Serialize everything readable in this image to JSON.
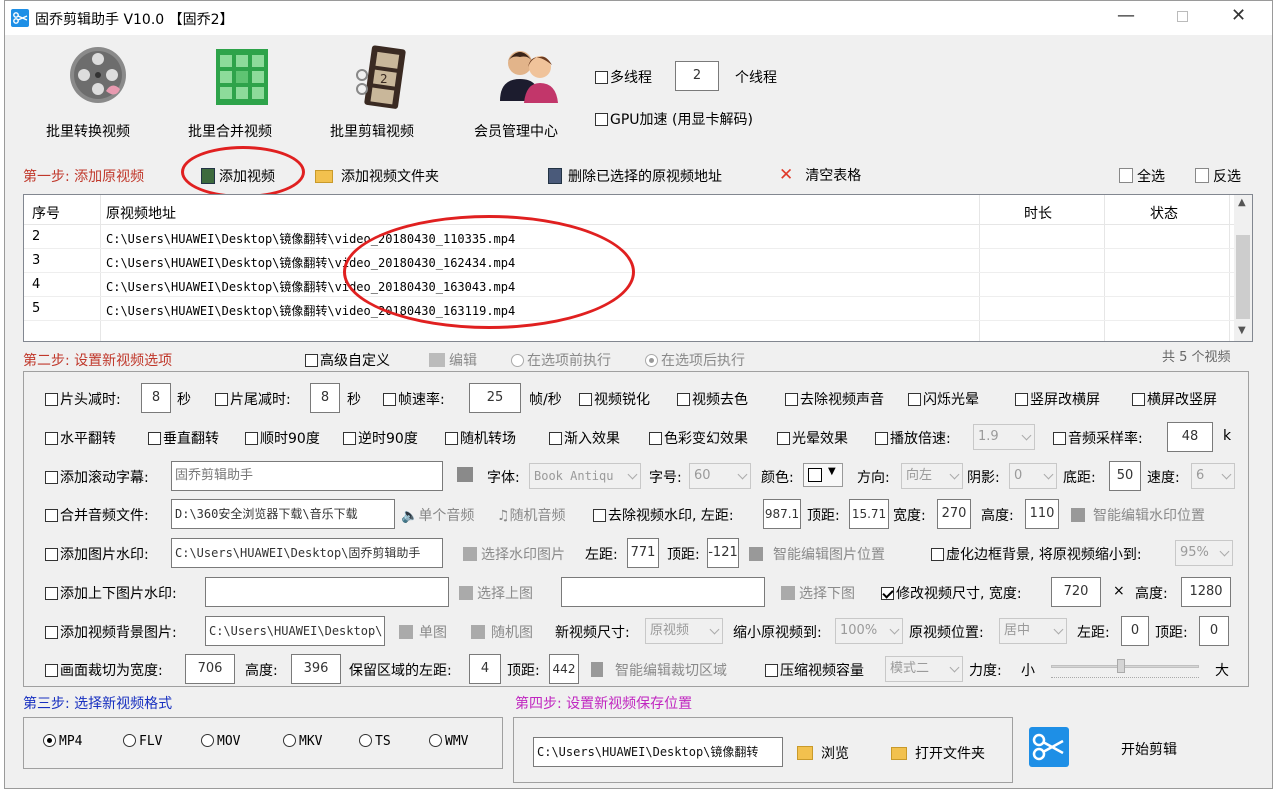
{
  "title": "固乔剪辑助手 V10.0 【固乔2】",
  "toolbar": {
    "items": [
      {
        "label": "批里转换视频",
        "icon": "film-reel-icon"
      },
      {
        "label": "批里合并视频",
        "icon": "film-grid-icon"
      },
      {
        "label": "批里剪辑视频",
        "icon": "film-strip-icon"
      },
      {
        "label": "会员管理中心",
        "icon": "users-icon"
      }
    ],
    "multithread_label": "多线程",
    "thread_count": "2",
    "thread_unit": "个线程",
    "gpu_label": "GPU加速 (用显卡解码)"
  },
  "step1": {
    "label": "第一步: 添加原视频",
    "add_video": "添加视频",
    "add_folder": "添加视频文件夹",
    "delete_selected": "删除已选择的原视频地址",
    "clear_table": "清空表格",
    "select_all": "全选",
    "invert": "反选"
  },
  "table": {
    "headers": [
      "序号",
      "原视频地址",
      "时长",
      "状态"
    ],
    "rows": [
      {
        "no": "2",
        "path": "C:\\Users\\HUAWEI\\Desktop\\镜像翻转\\video_20180430_110335.mp4",
        "duration": "",
        "status": ""
      },
      {
        "no": "3",
        "path": "C:\\Users\\HUAWEI\\Desktop\\镜像翻转\\video_20180430_162434.mp4",
        "duration": "",
        "status": ""
      },
      {
        "no": "4",
        "path": "C:\\Users\\HUAWEI\\Desktop\\镜像翻转\\video_20180430_163043.mp4",
        "duration": "",
        "status": ""
      },
      {
        "no": "5",
        "path": "C:\\Users\\HUAWEI\\Desktop\\镜像翻转\\video_20180430_163119.mp4",
        "duration": "",
        "status": ""
      }
    ]
  },
  "step2": {
    "label": "第二步: 设置新视频选项",
    "advanced": "高级自定义",
    "edit": "编辑",
    "before": "在选项前执行",
    "after": "在选项后执行",
    "count": "共 5 个视频"
  },
  "opts": {
    "head_cut": "片头减时:",
    "head_val": "8",
    "sec": "秒",
    "tail_cut": "片尾减时:",
    "tail_val": "8",
    "sec2": "秒",
    "fps": "帧速率:",
    "fps_val": "25",
    "fps_unit": "帧/秒",
    "sharpen": "视频锐化",
    "decolor": "视频去色",
    "remove_audio": "去除视频声音",
    "flash": "闪烁光晕",
    "v2h": "竖屏改横屏",
    "h2v": "横屏改竖屏",
    "hflip": "水平翻转",
    "vflip": "垂直翻转",
    "cw90": "顺时90度",
    "ccw90": "逆时90度",
    "random_trans": "随机转场",
    "fade": "渐入效果",
    "color_fx": "色彩变幻效果",
    "halo": "光晕效果",
    "speed": "播放倍速:",
    "speed_val": "1.9",
    "sample_rate": "音频采样率:",
    "sample_val": "48",
    "sample_unit": "k",
    "subtitle": "添加滚动字幕:",
    "subtitle_val": "固乔剪辑助手",
    "font": "字体:",
    "font_val": "Book Antiqu",
    "size": "字号:",
    "size_val": "60",
    "color": "颜色:",
    "direction": "方向:",
    "direction_val": "向左",
    "shadow": "阴影:",
    "shadow_val": "0",
    "bottom": "底距:",
    "bottom_val": "50",
    "speed2": "速度:",
    "speed2_val": "6",
    "merge_audio": "合并音频文件:",
    "audio_path": "D:\\360安全浏览器下载\\音乐下载",
    "single_audio": "单个音频",
    "random_audio": "随机音频",
    "remove_wm": "去除视频水印, 左距:",
    "wm_left": "987.1",
    "wm_top_label": "顶距:",
    "wm_top": "15.71",
    "wm_w_label": "宽度:",
    "wm_w": "270",
    "wm_h_label": "高度:",
    "wm_h": "110",
    "smart_wm": "智能编辑水印位置",
    "img_wm": "添加图片水印:",
    "img_wm_path": "C:\\Users\\HUAWEI\\Desktop\\固乔剪辑助手",
    "choose_wm_img": "选择水印图片",
    "img_left_label": "左距:",
    "img_left": "771",
    "img_top_label": "顶距:",
    "img_top": "-121",
    "smart_img": "智能编辑图片位置",
    "blur_border": "虚化边框背景, 将原视频缩小到:",
    "blur_val": "95%",
    "tb_wm": "添加上下图片水印:",
    "choose_top": "选择上图",
    "choose_bottom": "选择下图",
    "resize": "修改视频尺寸, 宽度:",
    "resize_w": "720",
    "times": "×",
    "resize_h_label": "高度:",
    "resize_h": "1280",
    "bg_img": "添加视频背景图片:",
    "bg_path": "C:\\Users\\HUAWEI\\Desktop\\",
    "single_img": "单图",
    "random_img": "随机图",
    "new_size": "新视频尺寸:",
    "new_size_val": "原视频",
    "shrink": "缩小原视频到:",
    "shrink_val": "100%",
    "position": "原视频位置:",
    "position_val": "居中",
    "pos_left_label": "左距:",
    "pos_left": "0",
    "pos_top_label": "顶距:",
    "pos_top": "0",
    "crop": "画面裁切为宽度:",
    "crop_w": "706",
    "crop_h_label": "高度:",
    "crop_h": "396",
    "crop_left_label": "保留区域的左距:",
    "crop_left": "4",
    "crop_top_label": "顶距:",
    "crop_top": "442",
    "smart_crop": "智能编辑裁切区域",
    "compress": "压缩视频容量",
    "compress_mode": "模式二",
    "strength": "力度:",
    "small": "小",
    "big": "大"
  },
  "step3": {
    "label": "第三步: 选择新视频格式",
    "formats": [
      "MP4",
      "FLV",
      "MOV",
      "MKV",
      "TS",
      "WMV"
    ]
  },
  "step4": {
    "label": "第四步: 设置新视频保存位置",
    "path": "C:\\Users\\HUAWEI\\Desktop\\镜像翻转",
    "browse": "浏览",
    "open_folder": "打开文件夹",
    "start": "开始剪辑"
  },
  "colors": {
    "red_label": "#c0382b",
    "step3": "#1830c0",
    "step4": "#c026c0",
    "annotation": "#e02020"
  }
}
